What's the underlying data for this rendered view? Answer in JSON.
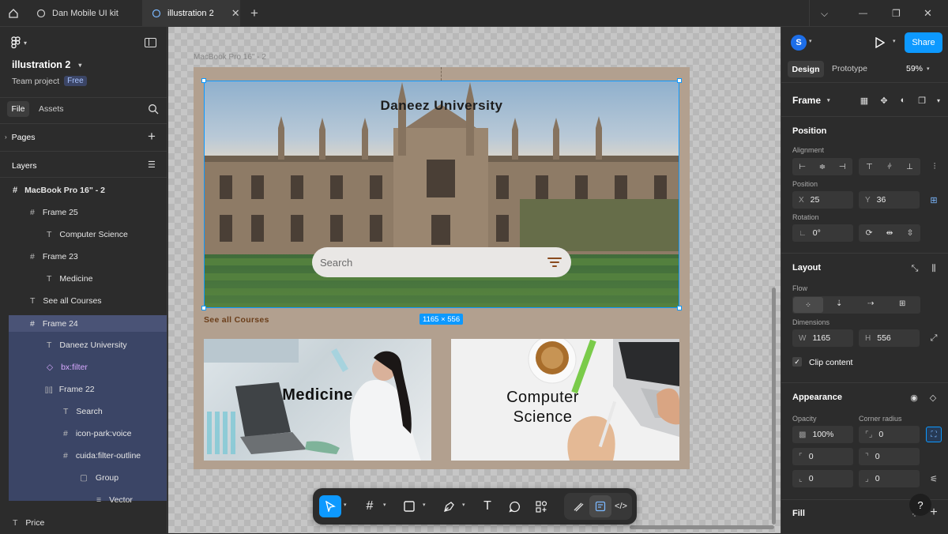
{
  "tabs": {
    "file_tab": "Dan Mobile UI kit",
    "active_tab": "illustration 2"
  },
  "left": {
    "file_name": "illustration 2",
    "project": "Team project",
    "plan_badge": "Free",
    "file_label": "File",
    "assets_label": "Assets",
    "pages_label": "Pages",
    "layers_label": "Layers",
    "layers": [
      {
        "name": "MacBook Pro 16\" - 2",
        "icon": "#"
      },
      {
        "name": "Frame 25",
        "icon": "#"
      },
      {
        "name": "Computer Science",
        "icon": "T"
      },
      {
        "name": "Frame 23",
        "icon": "#"
      },
      {
        "name": "Medicine",
        "icon": "T"
      },
      {
        "name": "See all Courses",
        "icon": "T"
      },
      {
        "name": "Frame 24",
        "icon": "#"
      },
      {
        "name": "Daneez University",
        "icon": "T"
      },
      {
        "name": "bx:filter",
        "icon": "◇"
      },
      {
        "name": "Frame 22",
        "icon": "[]"
      },
      {
        "name": "Search",
        "icon": "T"
      },
      {
        "name": "icon-park:voice",
        "icon": "#"
      },
      {
        "name": "cuida:filter-outline",
        "icon": "#"
      },
      {
        "name": "Group",
        "icon": "▢"
      },
      {
        "name": "Vector",
        "icon": "≡"
      },
      {
        "name": "Price",
        "icon": "T"
      }
    ]
  },
  "canvas": {
    "frame_label": "MacBook Pro 16\" - 2",
    "title": "Daneez University",
    "search_placeholder": "Search",
    "see_all": "See all Courses",
    "dimension_badge": "1165 × 556",
    "card1": "Medicine",
    "card2_line1": "Computer",
    "card2_line2": "Science"
  },
  "right": {
    "avatar": "S",
    "share": "Share",
    "design_tab": "Design",
    "prototype_tab": "Prototype",
    "zoom": "59%",
    "frame_label": "Frame",
    "position_label": "Position",
    "alignment_label": "Alignment",
    "pos_sub": "Position",
    "x_key": "X",
    "x_val": "25",
    "y_key": "Y",
    "y_val": "36",
    "rotation_label": "Rotation",
    "rotation_val": "0°",
    "layout_label": "Layout",
    "flow_label": "Flow",
    "dimensions_label": "Dimensions",
    "w_key": "W",
    "w_val": "1165",
    "h_key": "H",
    "h_val": "556",
    "clip_label": "Clip content",
    "appearance_label": "Appearance",
    "opacity_label": "Opacity",
    "opacity_val": "100%",
    "radius_label": "Corner radius",
    "radius_val": "0",
    "c1": "0",
    "c2": "0",
    "c3": "0",
    "c4": "0",
    "fill_label": "Fill"
  },
  "colors": {
    "accent": "#0d99ff",
    "selection": "#4a5376",
    "frame_bg": "#b2a08f",
    "see_all": "#6b3e1a"
  }
}
